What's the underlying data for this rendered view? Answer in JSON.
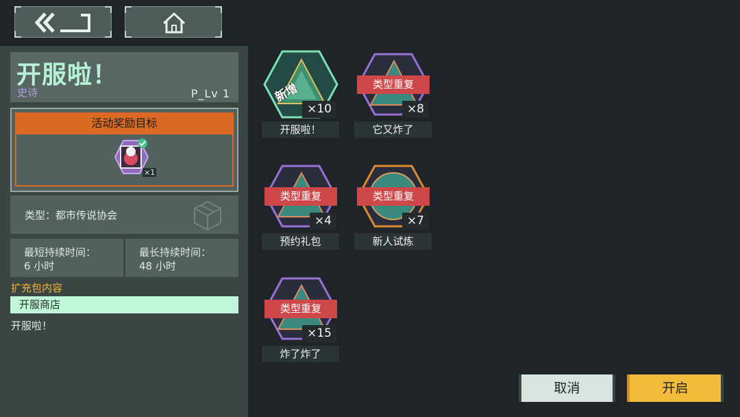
{
  "nav": {
    "back_icon": "double-chevron-left-icon",
    "home_icon": "home-icon"
  },
  "pack": {
    "title": "开服啦！",
    "rarity": "史诗",
    "level": "P_Lv   1",
    "reward_header": "活动奖励目标",
    "reward_count": "×1",
    "type": "类型：都市传说协会",
    "min_duration_label": "最短持续时间：",
    "min_duration_value": "6 小时",
    "max_duration_label": "最长持续时间：",
    "max_duration_value": "48 小时",
    "expand_label": "扩充包内容",
    "shop": "开服商店",
    "description": "开服啦！"
  },
  "cards": [
    {
      "name": "开服啦！",
      "count": "×10",
      "tag": "新增",
      "color": "#7ce0b5"
    },
    {
      "name": "它又炸了",
      "count": "×8",
      "tag": "类型重复",
      "color": "#9a70d8"
    },
    {
      "name": "预约礼包",
      "count": "×4",
      "tag": "类型重复",
      "color": "#9a70d8"
    },
    {
      "name": "新人试炼",
      "count": "×7",
      "tag": "类型重复",
      "color": "#e08a32"
    },
    {
      "name": "炸了炸了",
      "count": "×15",
      "tag": "类型重复",
      "color": "#9a70d8"
    }
  ],
  "buttons": {
    "cancel": "取消",
    "open": "开启"
  }
}
